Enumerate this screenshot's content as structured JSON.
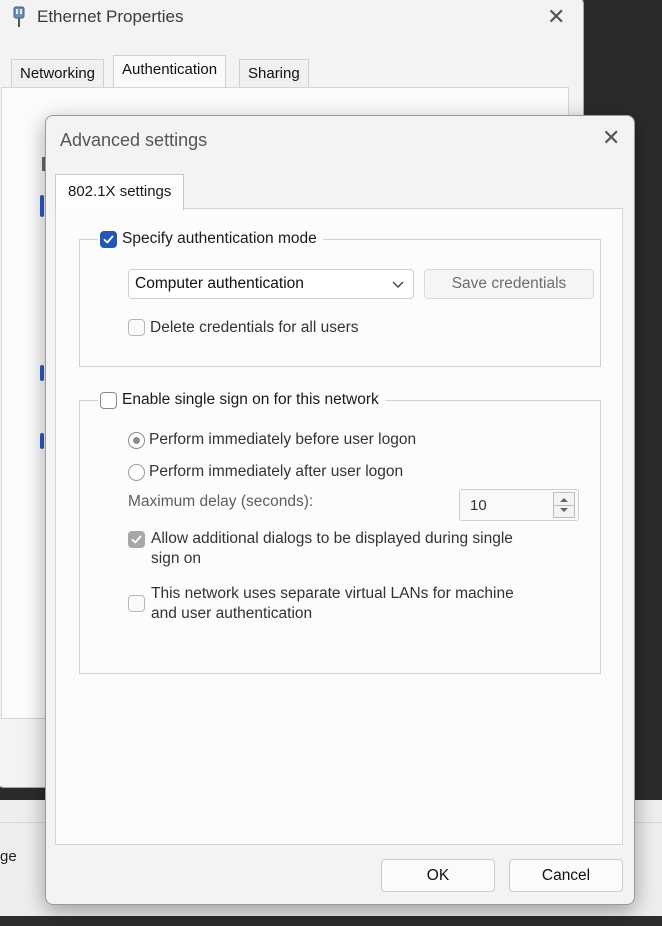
{
  "background_window": {
    "title": "Ethernet Properties",
    "tabs": [
      {
        "label": "Networking"
      },
      {
        "label": "Authentication"
      },
      {
        "label": "Sharing"
      }
    ],
    "partial_button_label": "ge"
  },
  "dialog": {
    "title": "Advanced settings",
    "tab_label": "802.1X settings",
    "specify_auth": {
      "label": "Specify authentication mode",
      "checked": true,
      "mode_value": "Computer authentication",
      "save_credentials_label": "Save credentials",
      "delete_credentials_label": "Delete credentials for all users"
    },
    "sso": {
      "label": "Enable single sign on for this network",
      "checked": false,
      "before_logon_label": "Perform immediately before user logon",
      "after_logon_label": "Perform immediately after user logon",
      "max_delay_label": "Maximum delay (seconds):",
      "max_delay_value": "10",
      "allow_dialogs_label_1": "Allow additional dialogs to be displayed during single",
      "allow_dialogs_label_2": "sign on",
      "vlan_label_1": "This network uses separate virtual LANs for machine",
      "vlan_label_2": "and user authentication"
    },
    "ok_label": "OK",
    "cancel_label": "Cancel"
  },
  "colors": {
    "accent": "#2356b6",
    "window_bg": "#f3f3f3",
    "desktop_bg": "#2b2b2b"
  }
}
